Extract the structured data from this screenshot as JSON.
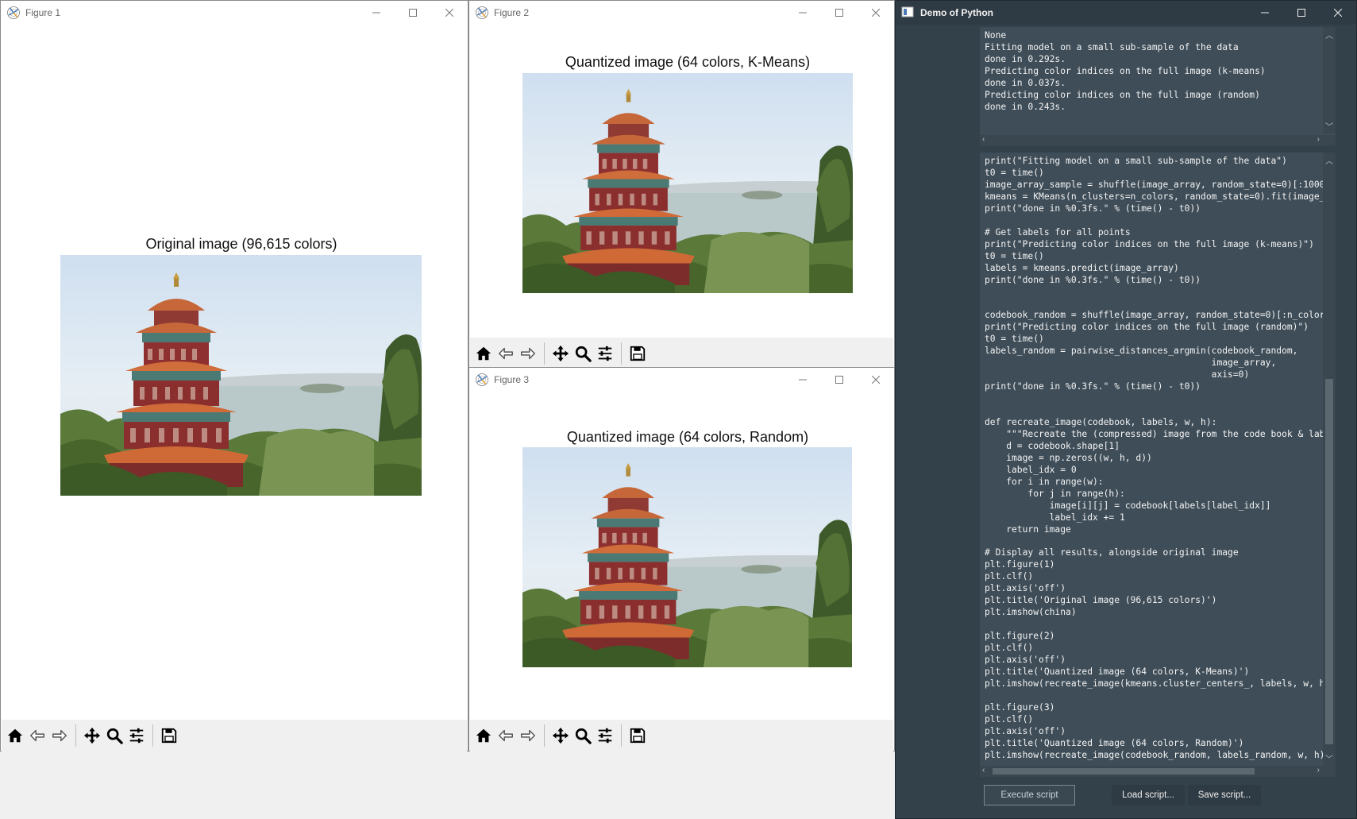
{
  "fig1": {
    "title": "Figure 1",
    "plot_title": "Original image (96,615 colors)"
  },
  "fig2": {
    "title": "Figure 2",
    "plot_title": "Quantized image (64 colors, K-Means)"
  },
  "fig3": {
    "title": "Figure 3",
    "plot_title": "Quantized image (64 colors, Random)"
  },
  "toolbar": {
    "icons": [
      "home-icon",
      "back-arrow-icon",
      "forward-arrow-icon",
      "pan-icon",
      "zoom-icon",
      "configure-subplots-icon",
      "save-icon"
    ]
  },
  "demo": {
    "title": "Demo of Python",
    "output_lines": "None\nFitting model on a small sub-sample of the data\ndone in 0.292s.\nPredicting color indices on the full image (k-means)\ndone in 0.037s.\nPredicting color indices on the full image (random)\ndone in 0.243s.",
    "code_lines": "print(\"Fitting model on a small sub-sample of the data\")\nt0 = time()\nimage_array_sample = shuffle(image_array, random_state=0)[:1000\nkmeans = KMeans(n_clusters=n_colors, random_state=0).fit(image_\nprint(\"done in %0.3fs.\" % (time() - t0))\n\n# Get labels for all points\nprint(\"Predicting color indices on the full image (k-means)\")\nt0 = time()\nlabels = kmeans.predict(image_array)\nprint(\"done in %0.3fs.\" % (time() - t0))\n\n\ncodebook_random = shuffle(image_array, random_state=0)[:n_color\nprint(\"Predicting color indices on the full image (random)\")\nt0 = time()\nlabels_random = pairwise_distances_argmin(codebook_random,\n                                          image_array,\n                                          axis=0)\nprint(\"done in %0.3fs.\" % (time() - t0))\n\n\ndef recreate_image(codebook, labels, w, h):\n    \"\"\"Recreate the (compressed) image from the code book & lab\n    d = codebook.shape[1]\n    image = np.zeros((w, h, d))\n    label_idx = 0\n    for i in range(w):\n        for j in range(h):\n            image[i][j] = codebook[labels[label_idx]]\n            label_idx += 1\n    return image\n\n# Display all results, alongside original image\nplt.figure(1)\nplt.clf()\nplt.axis('off')\nplt.title('Original image (96,615 colors)')\nplt.imshow(china)\n\nplt.figure(2)\nplt.clf()\nplt.axis('off')\nplt.title('Quantized image (64 colors, K-Means)')\nplt.imshow(recreate_image(kmeans.cluster_centers_, labels, w, h\n\nplt.figure(3)\nplt.clf()\nplt.axis('off')\nplt.title('Quantized image (64 colors, Random)')\nplt.imshow(recreate_image(codebook_random, labels_random, w, h)",
    "execute_label": "Execute script",
    "load_label": "Load script...",
    "save_label": "Save script..."
  },
  "window_icons": [
    "minimize-icon",
    "maximize-icon",
    "close-icon"
  ]
}
